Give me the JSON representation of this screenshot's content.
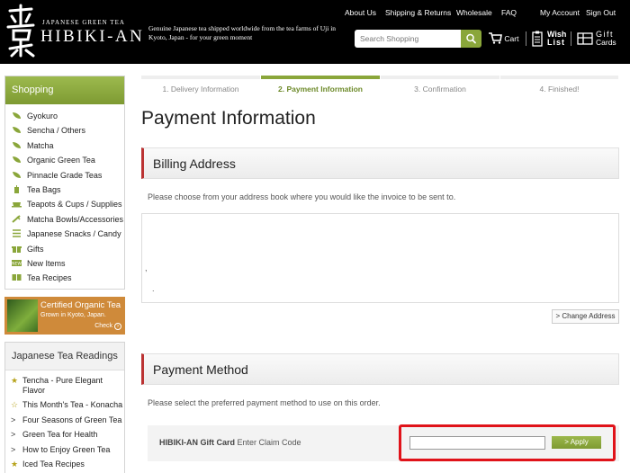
{
  "header": {
    "logo_small": "JAPANESE GREEN TEA",
    "logo_big": "HIBIKI-AN",
    "tagline": "Genuine Japanese tea shipped worldwide from the tea farms of Uji in Kyoto, Japan - for your green moment",
    "nav": [
      "About Us",
      "Shipping & Returns",
      "Wholesale",
      "FAQ",
      "My Account",
      "Sign Out"
    ],
    "search_placeholder": "Search Shopping",
    "cart_label": "Cart",
    "wishlist_label_1": "Wish",
    "wishlist_label_2": "List",
    "giftcards_label_1": "Gift",
    "giftcards_label_2": "Cards"
  },
  "sidebar": {
    "shopping_title": "Shopping",
    "items": [
      {
        "label": "Gyokuro",
        "icon": "tea-leaf-icon"
      },
      {
        "label": "Sencha / Others",
        "icon": "tea-leaf-icon"
      },
      {
        "label": "Matcha",
        "icon": "tea-leaf-icon"
      },
      {
        "label": "Organic Green Tea",
        "icon": "tea-leaf-icon"
      },
      {
        "label": "Pinnacle Grade Teas",
        "icon": "tea-leaf-icon"
      },
      {
        "label": "Tea Bags",
        "icon": "tea-bag-icon"
      },
      {
        "label": "Teapots & Cups / Supplies",
        "icon": "teapot-icon"
      },
      {
        "label": "Matcha Bowls/Accessories",
        "icon": "whisk-icon"
      },
      {
        "label": "Japanese Snacks / Candy",
        "icon": "snack-icon"
      },
      {
        "label": "Gifts",
        "icon": "gift-icon"
      },
      {
        "label": "New Items",
        "icon": "new-badge-icon"
      },
      {
        "label": "Tea Recipes",
        "icon": "book-icon"
      }
    ],
    "promo_title": "Certified Organic Tea",
    "promo_sub": "Grown in Kyoto, Japan.",
    "promo_check": "Check",
    "readings_title": "Japanese Tea Readings",
    "readings": [
      {
        "label": "Tencha - Pure Elegant Flavor",
        "icon": "star-icon",
        "glyph": "★",
        "color": "#b6a21a"
      },
      {
        "label": "This Month's Tea - Konacha",
        "icon": "star-outline-icon",
        "glyph": "☆",
        "color": "#b6a21a"
      },
      {
        "label": "Four Seasons of Green Tea",
        "icon": "chevron-right-icon",
        "glyph": ">",
        "color": "#333333"
      },
      {
        "label": "Green Tea for Health",
        "icon": "chevron-right-icon",
        "glyph": ">",
        "color": "#333333"
      },
      {
        "label": "How to Enjoy Green Tea",
        "icon": "chevron-right-icon",
        "glyph": ">",
        "color": "#333333"
      },
      {
        "label": "Iced Tea Recipes",
        "icon": "star-icon",
        "glyph": "★",
        "color": "#b6a21a"
      }
    ]
  },
  "checkout": {
    "steps": [
      "1. Delivery Information",
      "2. Payment Information",
      "3. Confirmation",
      "4. Finished!"
    ],
    "active_step": 1,
    "page_title": "Payment Information",
    "billing_title": "Billing Address",
    "billing_desc": "Please choose from your address book where you would like the invoice to be sent to.",
    "address_line_1": ",",
    "address_line_2": ".",
    "change_address_label": "> Change Address",
    "payment_title": "Payment Method",
    "payment_desc": "Please select the preferred payment method to use on this order.",
    "gift_card_bold": "HIBIKI-AN Gift Card",
    "gift_card_rest": " Enter Claim Code",
    "claim_code_value": "",
    "apply_label": "> Apply"
  },
  "colors": {
    "accent_green": "#8aa63a",
    "section_accent": "#bb3333",
    "highlight_red": "#e0131a",
    "promo_orange": "#cf8a3a"
  }
}
